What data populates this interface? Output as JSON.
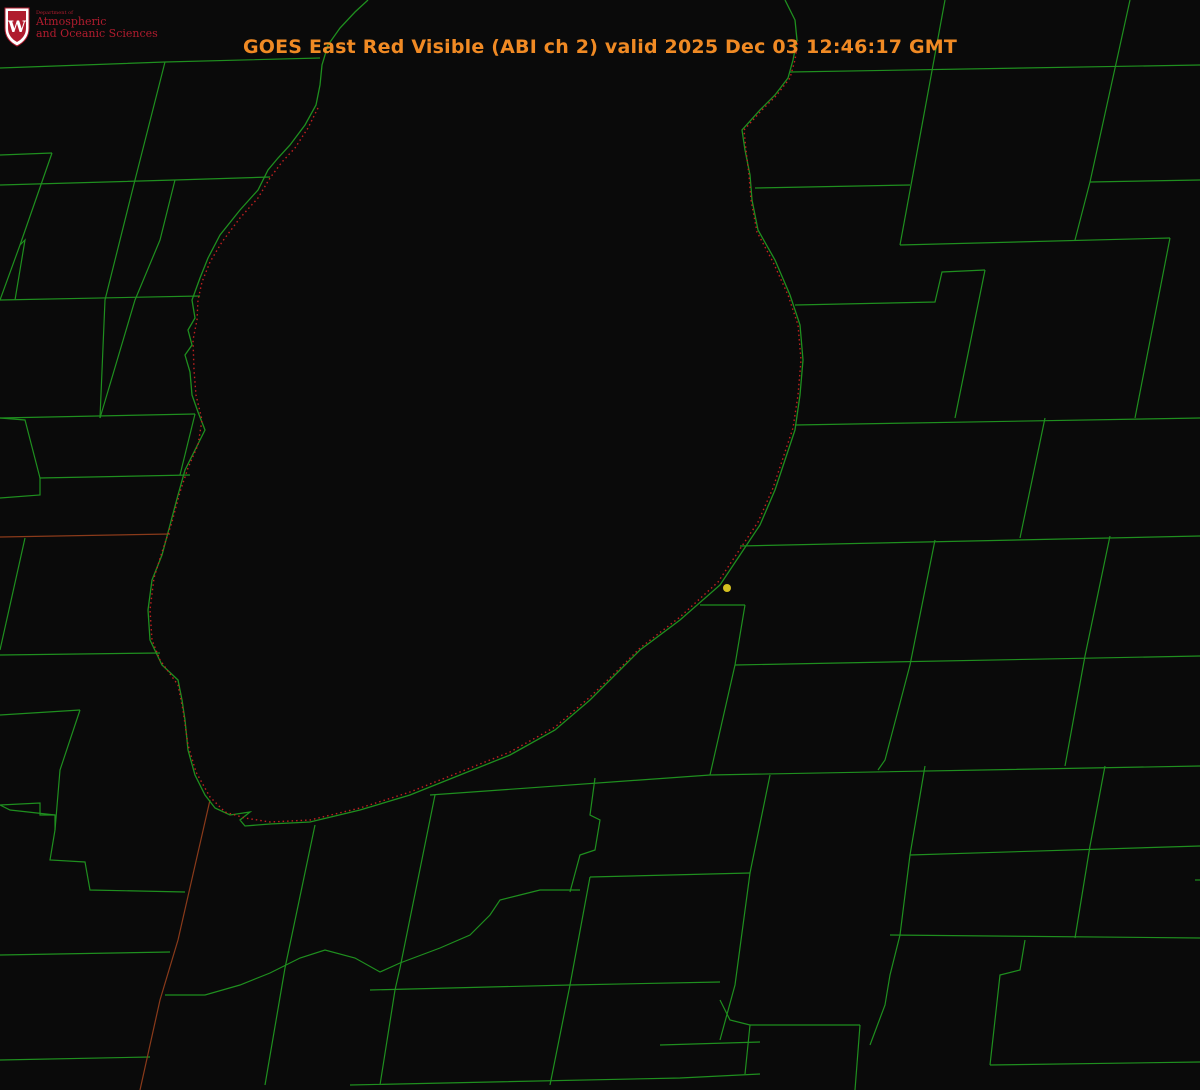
{
  "title": "GOES East Red Visible (ABI ch 2) valid 2025 Dec 03 12:46:17 GMT",
  "logo": {
    "line_small": "Department of",
    "line1": "Atmospheric",
    "line2": "and Oceanic Sciences",
    "shield_letter": "W"
  },
  "colors": {
    "background": "#0a0a0a",
    "county_lines": "#1f8f1f",
    "shoreline_dotted": "#c02020",
    "title": "#f08a24",
    "logo_text": "#b01c2e",
    "marker": "#d4c020"
  }
}
